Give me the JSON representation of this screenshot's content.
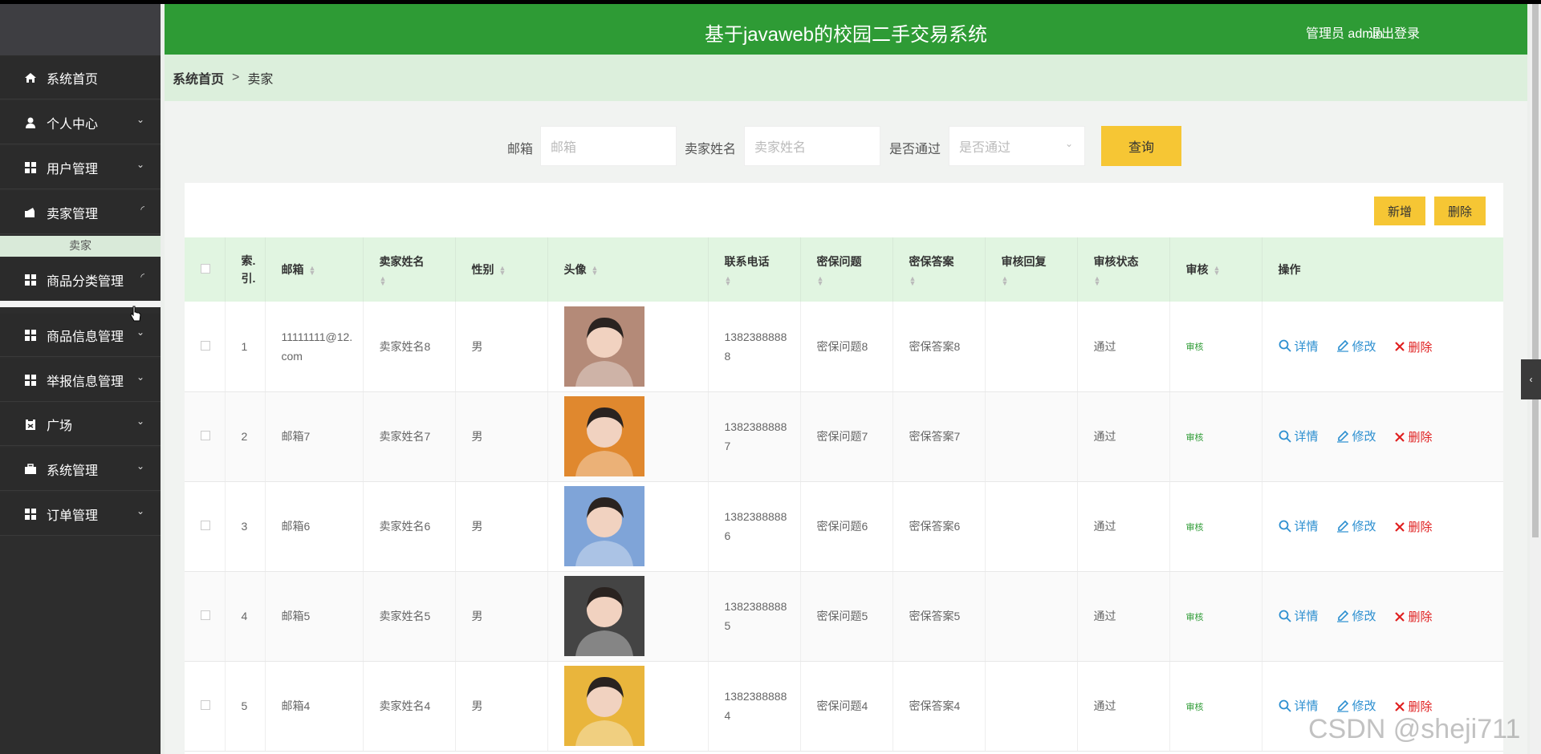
{
  "header": {
    "title": "基于javaweb的校园二手交易系统",
    "user": "管理员 admin",
    "logout": "退出登录"
  },
  "sidebar": {
    "items": [
      {
        "label": "系统首页",
        "icon": "home-icon"
      },
      {
        "label": "个人中心",
        "icon": "user-icon"
      },
      {
        "label": "用户管理",
        "icon": "grid-icon"
      },
      {
        "label": "卖家管理",
        "icon": "seller-icon"
      },
      {
        "label": "商品分类管理",
        "icon": "grid-icon"
      },
      {
        "label": "商品信息管理",
        "icon": "grid-icon"
      },
      {
        "label": "举报信息管理",
        "icon": "grid-icon"
      },
      {
        "label": "广场",
        "icon": "clipboard-icon"
      },
      {
        "label": "系统管理",
        "icon": "briefcase-icon"
      },
      {
        "label": "订单管理",
        "icon": "grid-icon"
      }
    ],
    "sub_item": "卖家"
  },
  "breadcrumb": {
    "home": "系统首页",
    "sep": ">",
    "current": "卖家"
  },
  "search": {
    "email_label": "邮箱",
    "email_placeholder": "邮箱",
    "name_label": "卖家姓名",
    "name_placeholder": "卖家姓名",
    "pass_label": "是否通过",
    "pass_placeholder": "是否通过",
    "query": "查询"
  },
  "toolbar": {
    "add": "新增",
    "delete": "删除"
  },
  "table": {
    "headers": [
      "索引",
      "邮箱",
      "卖家姓名",
      "性别",
      "头像",
      "联系电话",
      "密保问题",
      "密保答案",
      "审核回复",
      "审核状态",
      "审核",
      "操作"
    ],
    "index_header_line1": "索.",
    "index_header_line2": "引.",
    "rows": [
      {
        "idx": "1",
        "email": "11111111@12.com",
        "name": "卖家姓名8",
        "sex": "男",
        "phone": "13823888888",
        "q": "密保问题8",
        "a": "密保答案8",
        "reply": "",
        "status": "通过",
        "audit": "审核",
        "avatar_color": "#b48a78"
      },
      {
        "idx": "2",
        "email": "邮箱7",
        "name": "卖家姓名7",
        "sex": "男",
        "phone": "13823888887",
        "q": "密保问题7",
        "a": "密保答案7",
        "reply": "",
        "status": "通过",
        "audit": "审核",
        "avatar_color": "#e0882e"
      },
      {
        "idx": "3",
        "email": "邮箱6",
        "name": "卖家姓名6",
        "sex": "男",
        "phone": "13823888886",
        "q": "密保问题6",
        "a": "密保答案6",
        "reply": "",
        "status": "通过",
        "audit": "审核",
        "avatar_color": "#7fa4d8"
      },
      {
        "idx": "4",
        "email": "邮箱5",
        "name": "卖家姓名5",
        "sex": "男",
        "phone": "13823888885",
        "q": "密保问题5",
        "a": "密保答案5",
        "reply": "",
        "status": "通过",
        "audit": "审核",
        "avatar_color": "#444444"
      },
      {
        "idx": "5",
        "email": "邮箱4",
        "name": "卖家姓名4",
        "sex": "男",
        "phone": "13823888884",
        "q": "密保问题4",
        "a": "密保答案4",
        "reply": "",
        "status": "通过",
        "audit": "审核",
        "avatar_color": "#e9b53c"
      }
    ],
    "actions": {
      "detail": "详情",
      "edit": "修改",
      "delete": "删除"
    }
  },
  "watermark": "CSDN @sheji711"
}
